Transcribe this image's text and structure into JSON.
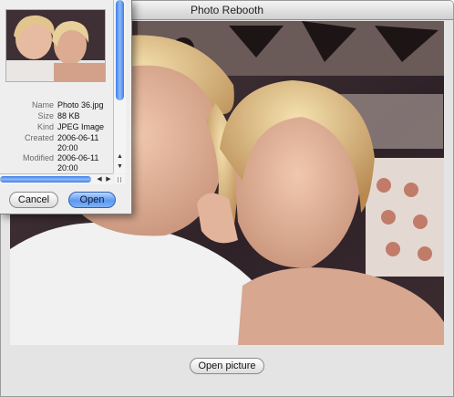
{
  "window": {
    "title": "Photo Rebooth"
  },
  "main": {
    "open_picture_label": "Open picture"
  },
  "dialog": {
    "info": [
      {
        "label": "Name",
        "value": "Photo 36.jpg"
      },
      {
        "label": "Size",
        "value": "88 KB"
      },
      {
        "label": "Kind",
        "value": "JPEG Image"
      },
      {
        "label": "Created",
        "value": "2006-06-11 20:00"
      },
      {
        "label": "Modified",
        "value": "2006-06-11 20:00"
      }
    ],
    "cancel_label": "Cancel",
    "open_label": "Open"
  },
  "colors": {
    "accent": "#5d98ee",
    "window_bg": "#e4e4e4"
  },
  "icons": {
    "scroll_up": "▲",
    "scroll_down": "▼",
    "scroll_left": "◀",
    "scroll_right": "▶"
  }
}
